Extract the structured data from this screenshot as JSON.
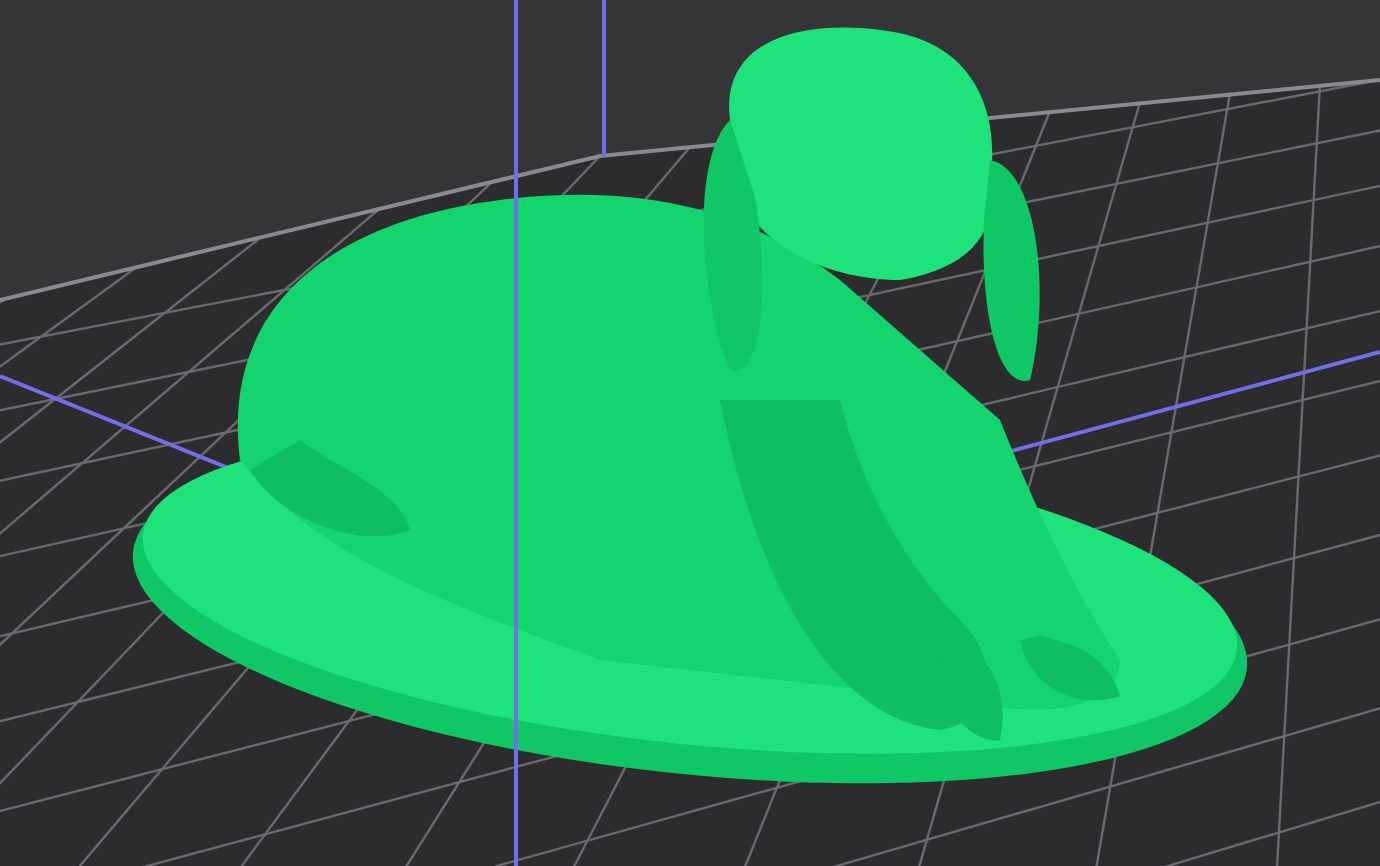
{
  "scene": {
    "kind": "print-bed"
  }
}
